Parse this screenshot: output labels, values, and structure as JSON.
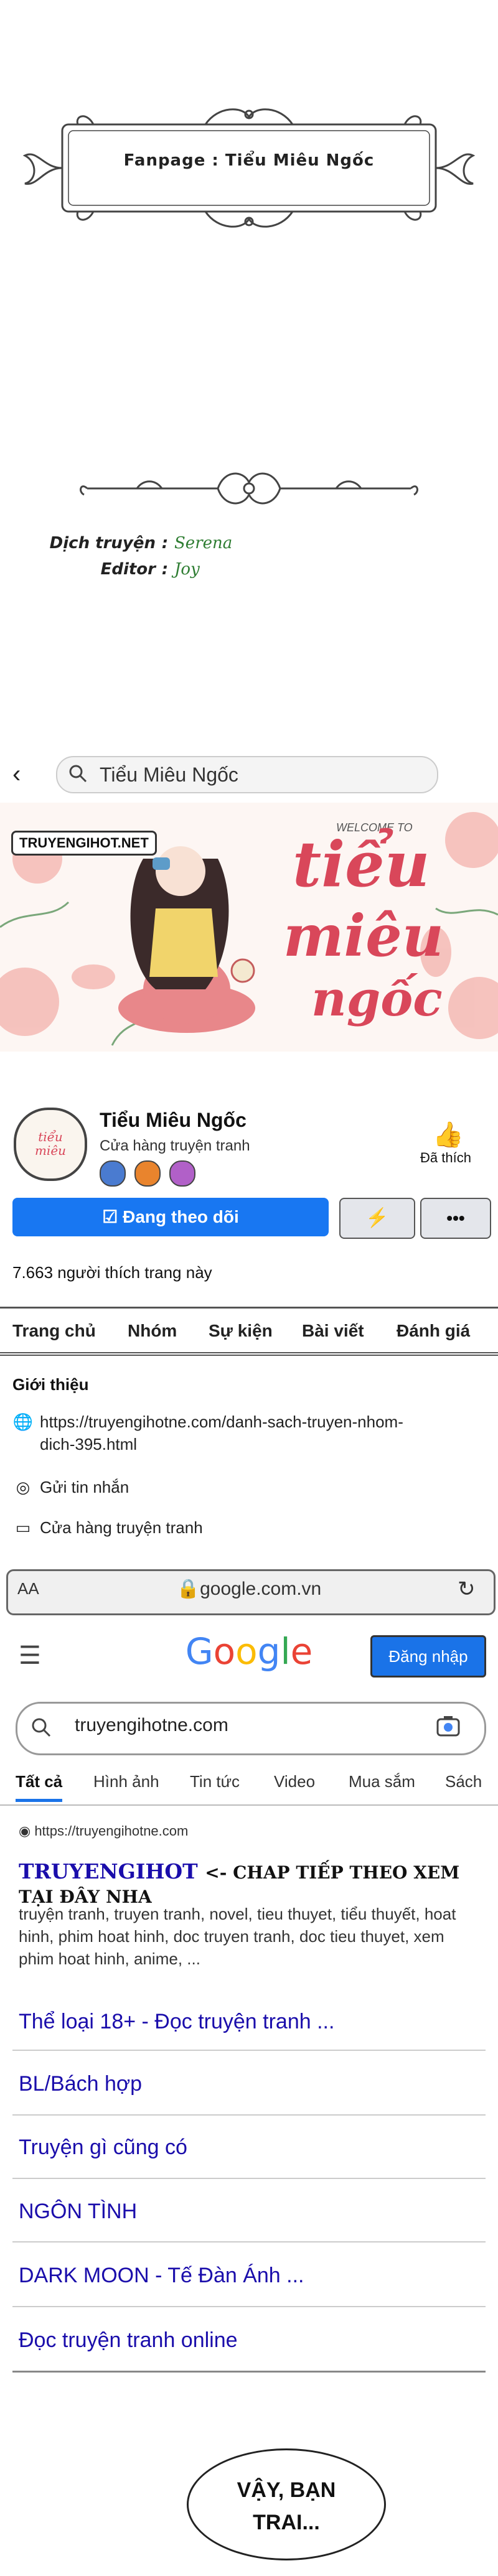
{
  "credits": {
    "fanpage": "Fanpage : Tiểu Miêu Ngốc",
    "translator_label": "Dịch truyện",
    "translator": "Serena",
    "editor_label": "Editor",
    "editor": "Joy",
    "separator": ":"
  },
  "facebook": {
    "search_text": "Tiểu Miêu Ngốc",
    "cover": {
      "brand": "TRUYENGIHOT.NET",
      "welcome": "WELCOME TO",
      "title_line1": "tiểu",
      "title_line2": "miêu",
      "title_line3": "ngốc"
    },
    "page_name": "Tiểu Miêu Ngốc",
    "page_category": "Cửa hàng truyện tranh",
    "liked_label": "Đã thích",
    "follow_label": "Đang theo dõi",
    "more_label": "•••",
    "likes_line": "7.663 người thích trang này",
    "tabs": [
      "Trang chủ",
      "Nhóm",
      "Sự kiện",
      "Bài viết",
      "Đánh giá"
    ],
    "intro_title": "Giới thiệu",
    "intro_link_line1": "https://truyengihotne.com/danh-sach-truyen-nhom-",
    "intro_link_line2": "dich-395.html",
    "send_message": "Gửi tin nhắn",
    "shop": "Cửa hàng truyện tranh"
  },
  "browser": {
    "aa": "AA",
    "url": "google.com.vn"
  },
  "google": {
    "logo": "Google",
    "login": "Đăng nhập",
    "query": "truyengihotne.com",
    "tabs": [
      "Tất cả",
      "Hình ảnh",
      "Tin tức",
      "Video",
      "Mua sắm",
      "Sách"
    ],
    "result": {
      "url": "https://truyengihotne.com",
      "title": "TRUYENGIHOT",
      "title_tag": "<- CHAP TIẾP THEO XEM TẠI ĐÂY NHA",
      "snippet": "truyện tranh, truyen tranh, novel, tieu thuyet, tiểu thuyết, hoat hinh, phim hoat hinh, doc truyen tranh, doc tieu thuyet, xem phim hoat hinh, anime, ..."
    },
    "sitelinks": [
      "Thể loại 18+ - Đọc truyện tranh ...",
      "BL/Bách hợp",
      "Truyện gì cũng có",
      "NGÔN TÌNH",
      "DARK MOON - Tế Đàn Ánh ...",
      "Đọc truyện tranh online"
    ]
  },
  "bubble": {
    "line1": "VẬY, BẠN",
    "line2": "TRAI..."
  }
}
